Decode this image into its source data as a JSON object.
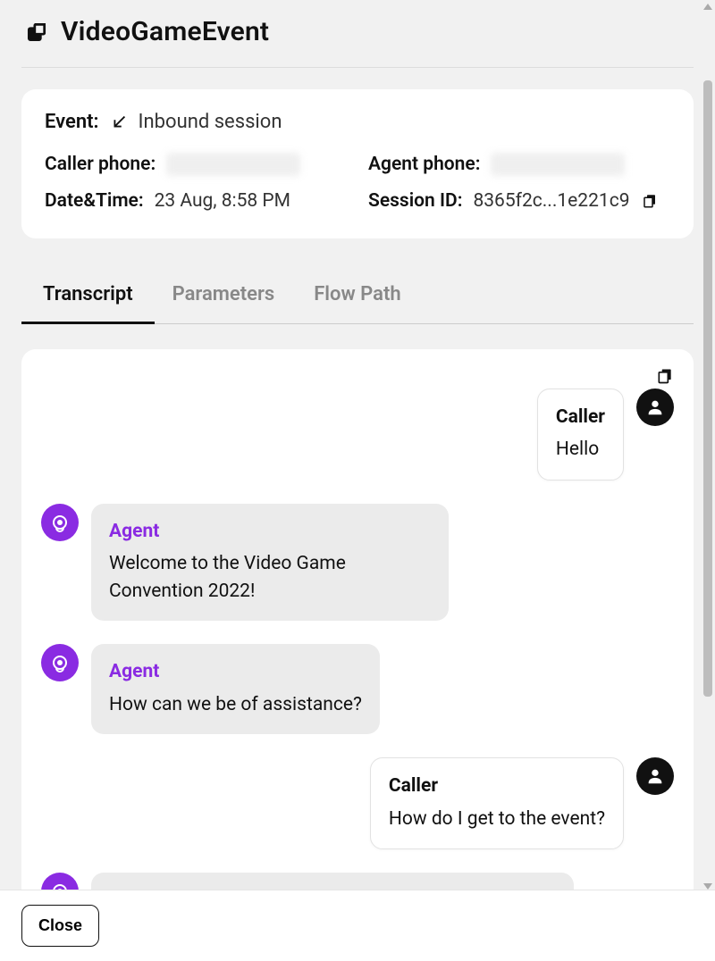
{
  "header": {
    "title": "VideoGameEvent"
  },
  "event": {
    "label": "Event:",
    "type": "Inbound session",
    "caller_phone_label": "Caller phone:",
    "agent_phone_label": "Agent phone:",
    "datetime_label": "Date&Time:",
    "datetime_value": "23 Aug, 8:58 PM",
    "session_label": "Session ID:",
    "session_value": "8365f2c...1e221c9"
  },
  "tabs": {
    "transcript": "Transcript",
    "parameters": "Parameters",
    "flow_path": "Flow Path"
  },
  "transcript": {
    "caller_label": "Caller",
    "agent_label": "Agent",
    "messages": [
      {
        "role": "caller",
        "text": "Hello"
      },
      {
        "role": "agent",
        "text": "Welcome to the Video Game Convention 2022!"
      },
      {
        "role": "agent",
        "text": "How can we be of assistance?"
      },
      {
        "role": "caller",
        "text": "How do I get to the event?"
      },
      {
        "role": "agent",
        "text": ""
      }
    ]
  },
  "footer": {
    "close": "Close"
  }
}
